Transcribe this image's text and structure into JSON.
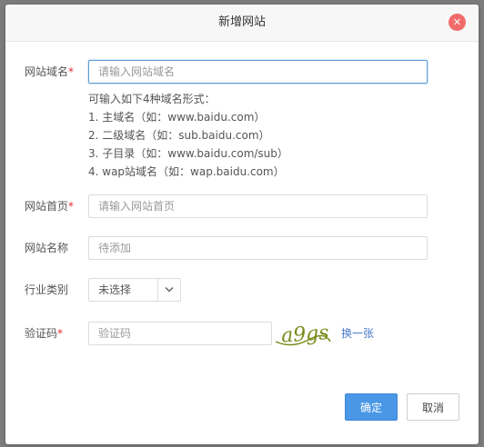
{
  "dialog": {
    "title": "新增网站",
    "close_glyph": "✕"
  },
  "form": {
    "domain": {
      "label": "网站域名",
      "required_mark": "*",
      "placeholder": "请输入网站域名",
      "value": ""
    },
    "hint": {
      "intro": "可输入如下4种域名形式：",
      "lines": [
        "1. 主域名（如：www.baidu.com）",
        "2. 二级域名（如：sub.baidu.com）",
        "3. 子目录（如：www.baidu.com/sub）",
        "4. wap站域名（如：wap.baidu.com）"
      ]
    },
    "homepage": {
      "label": "网站首页",
      "required_mark": "*",
      "placeholder": "请输入网站首页",
      "value": ""
    },
    "site_name": {
      "label": "网站名称",
      "placeholder": "待添加",
      "value": ""
    },
    "industry": {
      "label": "行业类别",
      "selected": "未选择"
    },
    "captcha": {
      "label": "验证码",
      "required_mark": "*",
      "placeholder": "验证码",
      "value": "",
      "image_text": "a9gs",
      "refresh_label": "换一张"
    }
  },
  "buttons": {
    "confirm": "确定",
    "cancel": "取消"
  },
  "colors": {
    "primary": "#4a97e6",
    "close": "#f26b6b",
    "required": "#e02e2e",
    "link": "#4a78c9",
    "captcha_ink": "#7a8a1a"
  }
}
